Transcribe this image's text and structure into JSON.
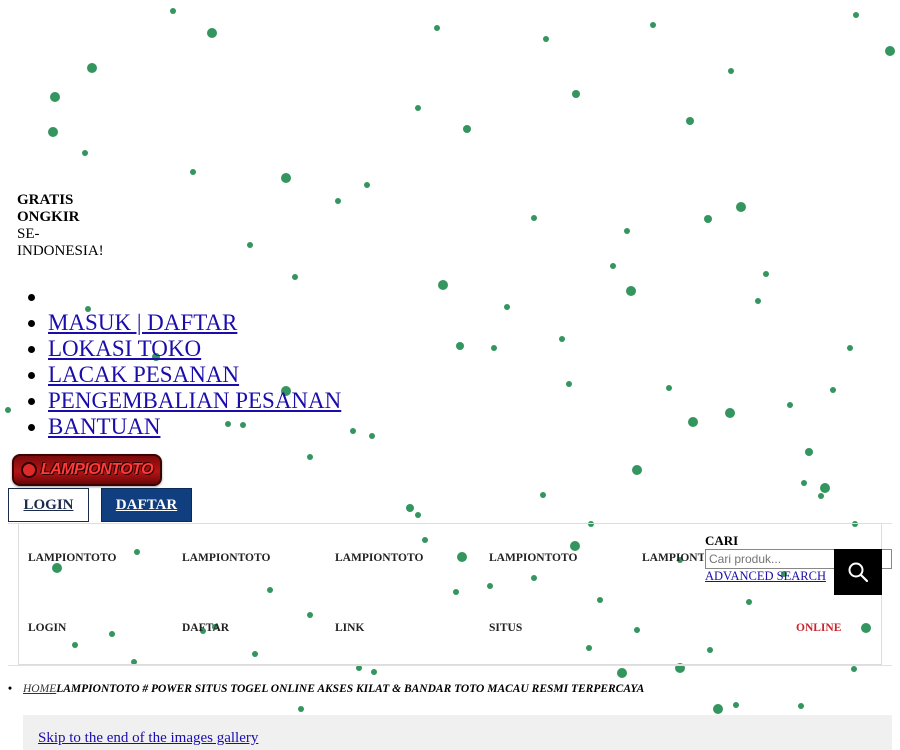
{
  "promo": {
    "line1": "GRATIS",
    "line2": "ONGKIR",
    "line3": "SE-",
    "line4": "INDONESIA!"
  },
  "top_links": [
    {
      "label": "MASUK | DAFTAR"
    },
    {
      "label": "LOKASI TOKO"
    },
    {
      "label": "LACAK PESANAN"
    },
    {
      "label": "PENGEMBALIAN PESANAN"
    },
    {
      "label": "BANTUAN"
    }
  ],
  "logo": {
    "text": "LAMPIONTOTO"
  },
  "auth": {
    "login_label": "LOGIN",
    "daftar_label": "DAFTAR"
  },
  "nav": {
    "row1": [
      "LAMPIONTOTO",
      "LAMPIONTOTO",
      "LAMPIONTOTO",
      "LAMPIONTOTO",
      "LAMPIONTO"
    ],
    "row2": [
      "LOGIN",
      "DAFTAR",
      "LINK",
      "SITUS",
      "ONLINE"
    ]
  },
  "search": {
    "label": "CARI",
    "placeholder": "Cari produk...",
    "advanced_label": "ADVANCED SEARCH"
  },
  "breadcrumb": {
    "home": "HOME",
    "current": "LAMPIONTOTO # POWER SITUS TOGEL ONLINE AKSES KILAT & BANDAR TOTO MACAU RESMI TERPERCAYA"
  },
  "gallery": {
    "skip_label": "Skip to the end of the images gallery"
  },
  "colors": {
    "dot": "#1e8a4c",
    "primary": "#113e7e",
    "online": "#c8262f",
    "logo": "#b51515"
  }
}
